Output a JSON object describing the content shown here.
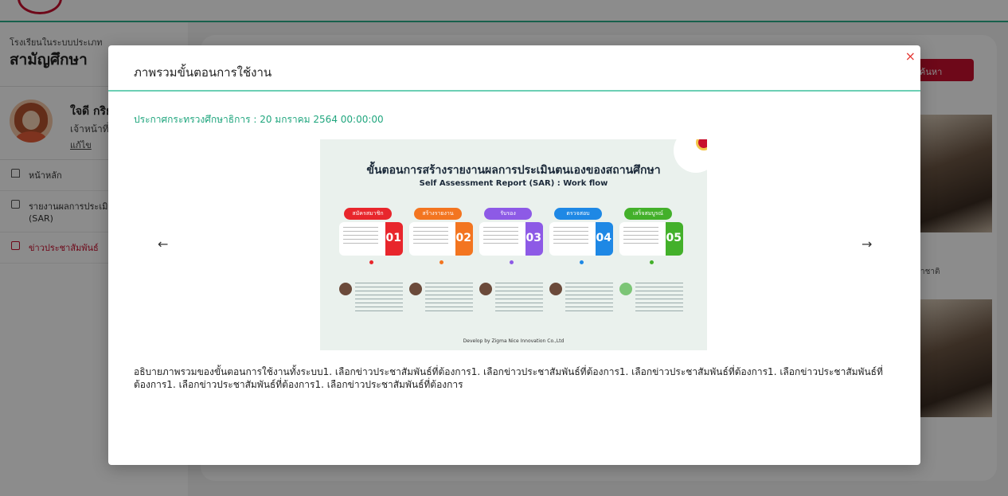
{
  "background": {
    "school_type": "โรงเรียนในระบบประเภท",
    "school_name": "สามัญศึกษา",
    "profile": {
      "name": "ใจดี กริย",
      "role": "เจ้าหน้าที่",
      "edit_label": "แก้ไข"
    },
    "nav": [
      {
        "label": "หน้าหลัก",
        "icon": "home-icon"
      },
      {
        "label": "รายงานผลการประเมิน สถานศึกษา (SAR)",
        "icon": "document-icon"
      },
      {
        "label": "ข่าวประชาสัมพันธ์",
        "icon": "news-icon"
      }
    ],
    "search_label": "ค้นหา",
    "thumb_caption": "าชาติ"
  },
  "modal": {
    "title": "ภาพรวมขั้นตอนการใช้งาน",
    "close_icon": "×",
    "announcement": "ประกาศกระทรวงศึกษาธิการ : 20 มกราคม 2564 00:00:00",
    "prev_icon": "←",
    "next_icon": "→",
    "description": "อธิบายภาพรวมของขั้นตอนการใช้งานทั้งระบบ1. เลือกข่าวประชาสัมพันธ์ที่ต้องการ1. เลือกข่าวประชาสัมพันธ์ที่ต้องการ1. เลือกข่าวประชาสัมพันธ์ที่ต้องการ1. เลือกข่าวประชาสัมพันธ์ที่ต้องการ1. เลือกข่าวประชาสัมพันธ์ที่ต้องการ1. เลือกข่าวประชาสัมพันธ์ที่ต้องการ"
  },
  "infographic": {
    "title": "ขั้นตอนการสร้างรายงานผลการประเมินตนเองของสถานศึกษา",
    "subtitle": "Self Assessment Report (SAR) : Work flow",
    "steps": [
      {
        "tab": "สมัครสมาชิก",
        "num": "01",
        "color": "#e8262c"
      },
      {
        "tab": "สร้างรายงาน",
        "num": "02",
        "color": "#f37520"
      },
      {
        "tab": "รับรอง",
        "num": "03",
        "color": "#8d5ae6"
      },
      {
        "tab": "ตรวจสอบ",
        "num": "04",
        "color": "#1e88e5"
      },
      {
        "tab": "เสร็จสมบูรณ์",
        "num": "05",
        "color": "#43b02a"
      }
    ],
    "footer": "Develop by Zigma Nice Innovation Co.,Ltd"
  }
}
